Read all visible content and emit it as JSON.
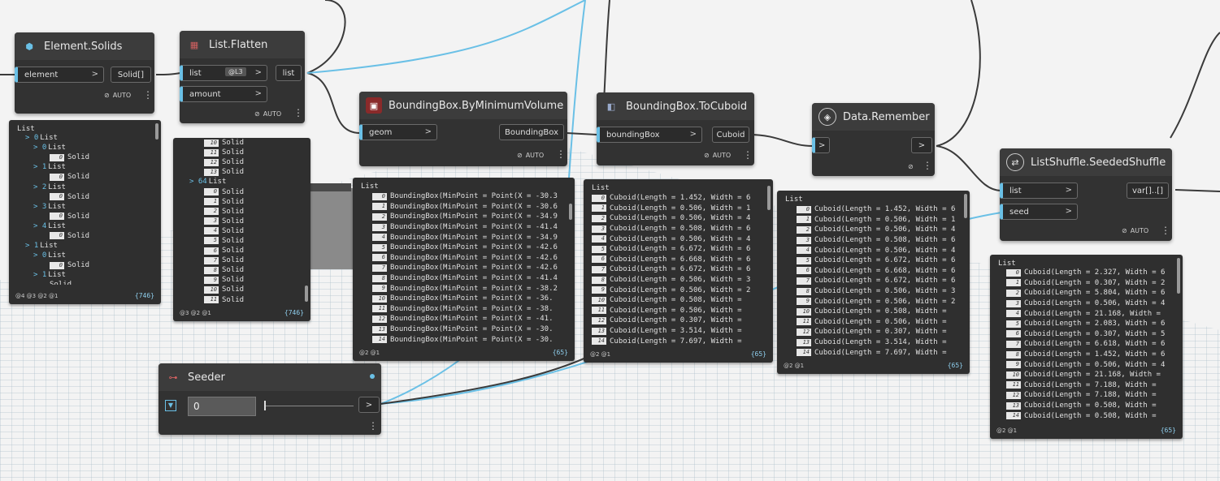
{
  "colors": {
    "wire": "#6ac0e6",
    "wire_dark": "#3a3a3a",
    "node_bg": "#323232",
    "header_bg": "#3c3c3c",
    "preview_count": "#8fcfee"
  },
  "nodes": {
    "element_solids": {
      "title": "Element.Solids",
      "icon": "element-icon",
      "input": "element",
      "output": "Solid[]",
      "run": "AUTO"
    },
    "list_flatten": {
      "title": "List.Flatten",
      "icon": "list-icon",
      "inputs": [
        "list",
        "amount"
      ],
      "level": "@L3",
      "output": "list",
      "run": "AUTO"
    },
    "bbox_min": {
      "title": "BoundingBox.ByMinimumVolume",
      "icon": "bbox-icon",
      "input": "geom",
      "output": "BoundingBox",
      "run": "AUTO"
    },
    "bbox_cuboid": {
      "title": "BoundingBox.ToCuboid",
      "icon": "cuboid-icon",
      "input": "boundingBox",
      "output": "Cuboid",
      "run": "AUTO"
    },
    "data_remember": {
      "title": "Data.Remember",
      "icon": "remember-icon",
      "input": ">",
      "output": ">"
    },
    "seeded_shuffle": {
      "title": "ListShuffle.SeededShuffle",
      "icon": "shuffle-icon",
      "inputs": [
        "list",
        "seed"
      ],
      "output": "var[]..[]",
      "run": "AUTO"
    },
    "seeder": {
      "title": "Seeder",
      "value": "0",
      "output": ">"
    }
  },
  "previews": {
    "p1": {
      "title": "List",
      "footer": "@4 @3 @2 @1",
      "count": "{746}",
      "rows": [
        [
          "> 0",
          "List"
        ],
        [
          "> 0",
          "List"
        ],
        [
          "0",
          "Solid"
        ],
        [
          "> 1",
          "List"
        ],
        [
          "0",
          "Solid"
        ],
        [
          "> 2",
          "List"
        ],
        [
          "0",
          "Solid"
        ],
        [
          "> 3",
          "List"
        ],
        [
          "0",
          "Solid"
        ],
        [
          "> 4",
          "List"
        ],
        [
          "0",
          "Solid"
        ],
        [
          "> 1",
          "List"
        ],
        [
          "> 0",
          "List"
        ],
        [
          "0",
          "Solid"
        ],
        [
          "> 1",
          "List"
        ],
        [
          "",
          "Solid"
        ]
      ]
    },
    "p2": {
      "title": "",
      "footer": "@3 @2 @1",
      "count": "{746}",
      "rows": [
        [
          "10",
          "Solid"
        ],
        [
          "11",
          "Solid"
        ],
        [
          "12",
          "Solid"
        ],
        [
          "13",
          "Solid"
        ],
        [
          "> 64",
          "List"
        ],
        [
          "0",
          "Solid"
        ],
        [
          "1",
          "Solid"
        ],
        [
          "2",
          "Solid"
        ],
        [
          "3",
          "Solid"
        ],
        [
          "4",
          "Solid"
        ],
        [
          "5",
          "Solid"
        ],
        [
          "6",
          "Solid"
        ],
        [
          "7",
          "Solid"
        ],
        [
          "8",
          "Solid"
        ],
        [
          "9",
          "Solid"
        ],
        [
          "10",
          "Solid"
        ],
        [
          "11",
          "Solid"
        ]
      ]
    },
    "p3": {
      "title": "List",
      "footer": "@2 @1",
      "count": "{65}",
      "rows": [
        [
          "0",
          "BoundingBox(MinPoint = Point(X = -30.3"
        ],
        [
          "1",
          "BoundingBox(MinPoint = Point(X = -30.6"
        ],
        [
          "2",
          "BoundingBox(MinPoint = Point(X = -34.9"
        ],
        [
          "3",
          "BoundingBox(MinPoint = Point(X = -41.4"
        ],
        [
          "4",
          "BoundingBox(MinPoint = Point(X = -34.9"
        ],
        [
          "5",
          "BoundingBox(MinPoint = Point(X = -42.6"
        ],
        [
          "6",
          "BoundingBox(MinPoint = Point(X = -42.6"
        ],
        [
          "7",
          "BoundingBox(MinPoint = Point(X = -42.6"
        ],
        [
          "8",
          "BoundingBox(MinPoint = Point(X = -41.4"
        ],
        [
          "9",
          "BoundingBox(MinPoint = Point(X = -38.2"
        ],
        [
          "10",
          "BoundingBox(MinPoint = Point(X = -36."
        ],
        [
          "11",
          "BoundingBox(MinPoint = Point(X = -38."
        ],
        [
          "12",
          "BoundingBox(MinPoint = Point(X = -41."
        ],
        [
          "13",
          "BoundingBox(MinPoint = Point(X = -30."
        ],
        [
          "14",
          "BoundingBox(MinPoint = Point(X = -30."
        ]
      ]
    },
    "p4": {
      "title": "List",
      "footer": "@2 @1",
      "count": "{65}",
      "rows": [
        [
          "0",
          "Cuboid(Length = 1.452, Width = 6"
        ],
        [
          "1",
          "Cuboid(Length = 0.506, Width = 1"
        ],
        [
          "2",
          "Cuboid(Length = 0.506, Width = 4"
        ],
        [
          "3",
          "Cuboid(Length = 0.508, Width = 6"
        ],
        [
          "4",
          "Cuboid(Length = 0.506, Width = 4"
        ],
        [
          "5",
          "Cuboid(Length = 6.672, Width = 6"
        ],
        [
          "6",
          "Cuboid(Length = 6.668, Width = 6"
        ],
        [
          "7",
          "Cuboid(Length = 6.672, Width = 6"
        ],
        [
          "8",
          "Cuboid(Length = 0.506, Width = 3"
        ],
        [
          "9",
          "Cuboid(Length = 0.506, Width = 2"
        ],
        [
          "10",
          "Cuboid(Length = 0.508, Width ="
        ],
        [
          "11",
          "Cuboid(Length = 0.506, Width ="
        ],
        [
          "12",
          "Cuboid(Length = 0.307, Width ="
        ],
        [
          "13",
          "Cuboid(Length = 3.514, Width ="
        ],
        [
          "14",
          "Cuboid(Length = 7.697, Width ="
        ]
      ]
    },
    "p5": {
      "title": "List",
      "footer": "@2 @1",
      "count": "{65}",
      "rows": [
        [
          "0",
          "Cuboid(Length = 1.452, Width = 6"
        ],
        [
          "1",
          "Cuboid(Length = 0.506, Width = 1"
        ],
        [
          "2",
          "Cuboid(Length = 0.506, Width = 4"
        ],
        [
          "3",
          "Cuboid(Length = 0.508, Width = 6"
        ],
        [
          "4",
          "Cuboid(Length = 0.506, Width = 4"
        ],
        [
          "5",
          "Cuboid(Length = 6.672, Width = 6"
        ],
        [
          "6",
          "Cuboid(Length = 6.668, Width = 6"
        ],
        [
          "7",
          "Cuboid(Length = 6.672, Width = 6"
        ],
        [
          "8",
          "Cuboid(Length = 0.506, Width = 3"
        ],
        [
          "9",
          "Cuboid(Length = 0.506, Width = 2"
        ],
        [
          "10",
          "Cuboid(Length = 0.508, Width ="
        ],
        [
          "11",
          "Cuboid(Length = 0.506, Width ="
        ],
        [
          "12",
          "Cuboid(Length = 0.307, Width ="
        ],
        [
          "13",
          "Cuboid(Length = 3.514, Width ="
        ],
        [
          "14",
          "Cuboid(Length = 7.697, Width ="
        ]
      ]
    },
    "p6": {
      "title": "List",
      "footer": "@2 @1",
      "count": "{65}",
      "rows": [
        [
          "0",
          "Cuboid(Length = 2.327, Width = 6"
        ],
        [
          "1",
          "Cuboid(Length = 0.307, Width = 2"
        ],
        [
          "2",
          "Cuboid(Length = 5.804, Width = 6"
        ],
        [
          "3",
          "Cuboid(Length = 0.506, Width = 4"
        ],
        [
          "4",
          "Cuboid(Length = 21.168, Width ="
        ],
        [
          "5",
          "Cuboid(Length = 2.083, Width = 6"
        ],
        [
          "6",
          "Cuboid(Length = 0.307, Width = 5"
        ],
        [
          "7",
          "Cuboid(Length = 6.618, Width = 6"
        ],
        [
          "8",
          "Cuboid(Length = 1.452, Width = 6"
        ],
        [
          "9",
          "Cuboid(Length = 0.506, Width = 4"
        ],
        [
          "10",
          "Cuboid(Length = 21.168, Width ="
        ],
        [
          "11",
          "Cuboid(Length = 7.188, Width ="
        ],
        [
          "12",
          "Cuboid(Length = 7.188, Width ="
        ],
        [
          "13",
          "Cuboid(Length = 0.508, Width ="
        ],
        [
          "14",
          "Cuboid(Length = 0.508, Width ="
        ]
      ]
    }
  }
}
